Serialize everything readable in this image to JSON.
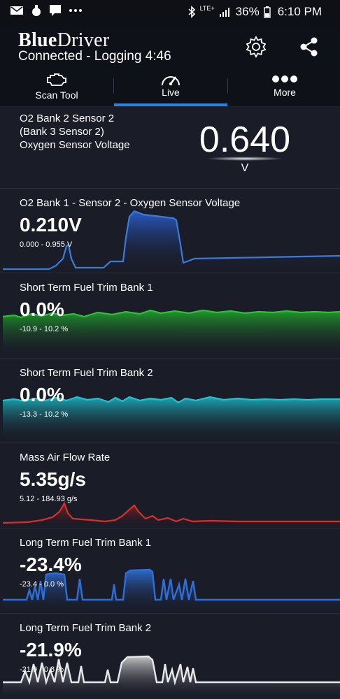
{
  "status_bar": {
    "left_icons": [
      "mail-icon",
      "bag-icon",
      "message-icon",
      "more-dots-icon"
    ],
    "network": "LTE+",
    "battery": "36%",
    "time": "6:10 PM"
  },
  "header": {
    "brand_bold": "Blue",
    "brand_light": "Driver",
    "status": "Connected - Logging 4:46",
    "settings_icon": "gear-icon",
    "share_icon": "share-icon"
  },
  "tabs": [
    {
      "label": "Scan Tool",
      "icon": "engine-icon"
    },
    {
      "label": "Live",
      "icon": "gauge-icon",
      "active": true
    },
    {
      "label": "More",
      "icon": "dots-icon"
    }
  ],
  "panels": [
    {
      "title_lines": [
        "O2 Bank 2 Sensor 2",
        "(Bank 3 Sensor 2)",
        "Oxygen Sensor Voltage"
      ],
      "value": "0.640",
      "unit": "V"
    },
    {
      "title": "O2 Bank 1 - Sensor 2 - Oxygen Sensor Voltage",
      "value": "0.210V",
      "range": "0.000 - 0.955 V",
      "color": "#3a7bd5"
    },
    {
      "title": "Short Term Fuel Trim Bank 1",
      "value": "0.0%",
      "range": "-10.9 - 10.2 %",
      "color": "#2fbf38"
    },
    {
      "title": "Short Term Fuel Trim Bank 2",
      "value": "0.0%",
      "range": "-13.3 - 10.2 %",
      "color": "#22c3cf"
    },
    {
      "title": "Mass Air Flow Rate",
      "value": "5.35g/s",
      "range": "5.12 - 184.93 g/s",
      "color": "#d6302a"
    },
    {
      "title": "Long Term Fuel Trim Bank 1",
      "value": "-23.4%",
      "range": "-23.4 - 0.0 %",
      "color": "#2d6fd6"
    },
    {
      "title": "Long Term Fuel Trim Bank 2",
      "value": "-21.9%",
      "range": "-21.9 - 0.8 %",
      "color": "#e8e8e8"
    }
  ]
}
